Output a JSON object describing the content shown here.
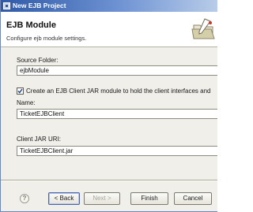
{
  "window": {
    "title": "New EJB Project"
  },
  "banner": {
    "title": "EJB Module",
    "description": "Configure ejb module settings.",
    "icon": "wizard-folder-icon"
  },
  "form": {
    "source_folder_label": "Source Folder:",
    "source_folder_value": "ejbModule",
    "client_jar_checkbox_label": "Create an EJB Client JAR module to hold the client interfaces and",
    "client_jar_checked": true,
    "name_label": "Name:",
    "name_value": "TicketEJBClient",
    "client_jar_uri_label": "Client JAR URI:",
    "client_jar_uri_value": "TicketEJBClient.jar"
  },
  "buttons": {
    "help_label": "?",
    "back_label": "< Back",
    "next_label": "Next >",
    "finish_label": "Finish",
    "cancel_label": "Cancel"
  },
  "colors": {
    "title_bar": "#2f5aa8",
    "dialog_background": "#f0efe9",
    "banner_background": "#ffffff"
  }
}
